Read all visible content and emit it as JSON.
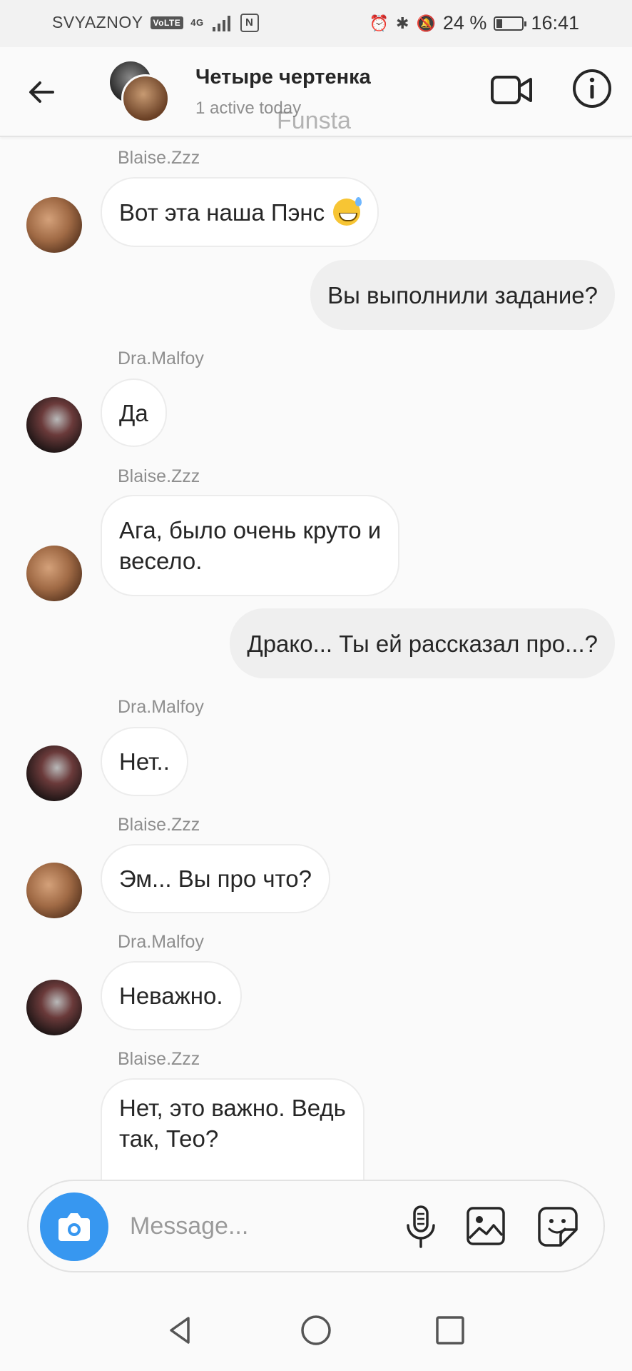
{
  "status_bar": {
    "carrier": "SVYAZNOY",
    "volte": "VoLTE",
    "network": "4G",
    "battery_percent": "24 %",
    "battery_level": 0.24,
    "time": "16:41"
  },
  "header": {
    "title": "Четыре чертенка",
    "subtitle": "1 active today",
    "watermark": "Funsta"
  },
  "messages": [
    {
      "direction": "in",
      "sender": "Blaise.Zzz",
      "text": "Вот эта наша Пэнс",
      "emoji": "sweat-smile-emoji"
    },
    {
      "direction": "out",
      "text": "Вы выполнили задание?"
    },
    {
      "direction": "in",
      "sender": "Dra.Malfoy",
      "text": "Да"
    },
    {
      "direction": "in",
      "sender": "Blaise.Zzz",
      "text_line1": "Ага, было очень круто и",
      "text_line2": "весело."
    },
    {
      "direction": "out",
      "text": "Драко... Ты ей рассказал про...?"
    },
    {
      "direction": "in",
      "sender": "Dra.Malfoy",
      "text": "Нет.."
    },
    {
      "direction": "in",
      "sender": "Blaise.Zzz",
      "text": "Эм... Вы про что?"
    },
    {
      "direction": "in",
      "sender": "Dra.Malfoy",
      "text": "Неважно."
    },
    {
      "direction": "in",
      "sender": "Blaise.Zzz",
      "text_line1": "Нет, это важно. Ведь",
      "text_line2": "так, Тео?"
    }
  ],
  "composer": {
    "placeholder": "Message..."
  },
  "icons": [
    "back-arrow-icon",
    "video-call-icon",
    "info-icon",
    "camera-icon",
    "microphone-icon",
    "gallery-icon",
    "sticker-icon",
    "nav-back-icon",
    "nav-home-icon",
    "nav-recents-icon"
  ]
}
